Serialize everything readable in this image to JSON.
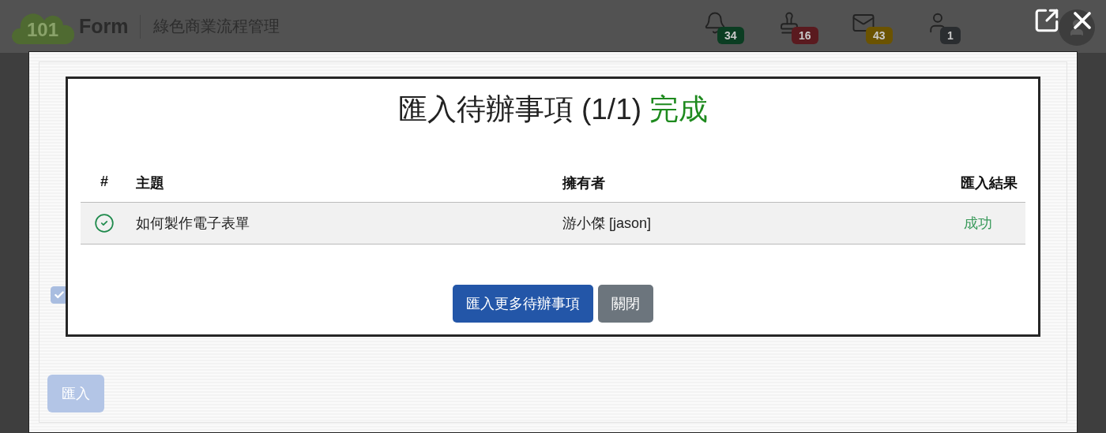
{
  "header": {
    "logo_number": "101",
    "logo_text": "Form",
    "subtitle": "綠色商業流程管理",
    "badges": [
      {
        "count": "34",
        "color": "#0b3d22"
      },
      {
        "count": "16",
        "color": "#5a1a1f"
      },
      {
        "count": "43",
        "color": "#6b5300"
      },
      {
        "count": "1",
        "color": "#2a2d30"
      }
    ]
  },
  "background_panel": {
    "checkbox_checked": true,
    "button": {
      "label": "匯入",
      "disabled": true
    }
  },
  "dialog": {
    "title": "匯入待辦事項 (1/1)",
    "status": "完成",
    "columns": [
      "#",
      "主題",
      "擁有者",
      "匯入結果"
    ],
    "rows": [
      {
        "kind": "success",
        "subject": "如何製作電子表單",
        "owner": "游小傑 [jason]",
        "result": "成功"
      }
    ],
    "buttons": [
      {
        "kind": "primary",
        "label": "匯入更多待辦事項"
      },
      {
        "kind": "secondary",
        "label": "關閉"
      }
    ]
  }
}
